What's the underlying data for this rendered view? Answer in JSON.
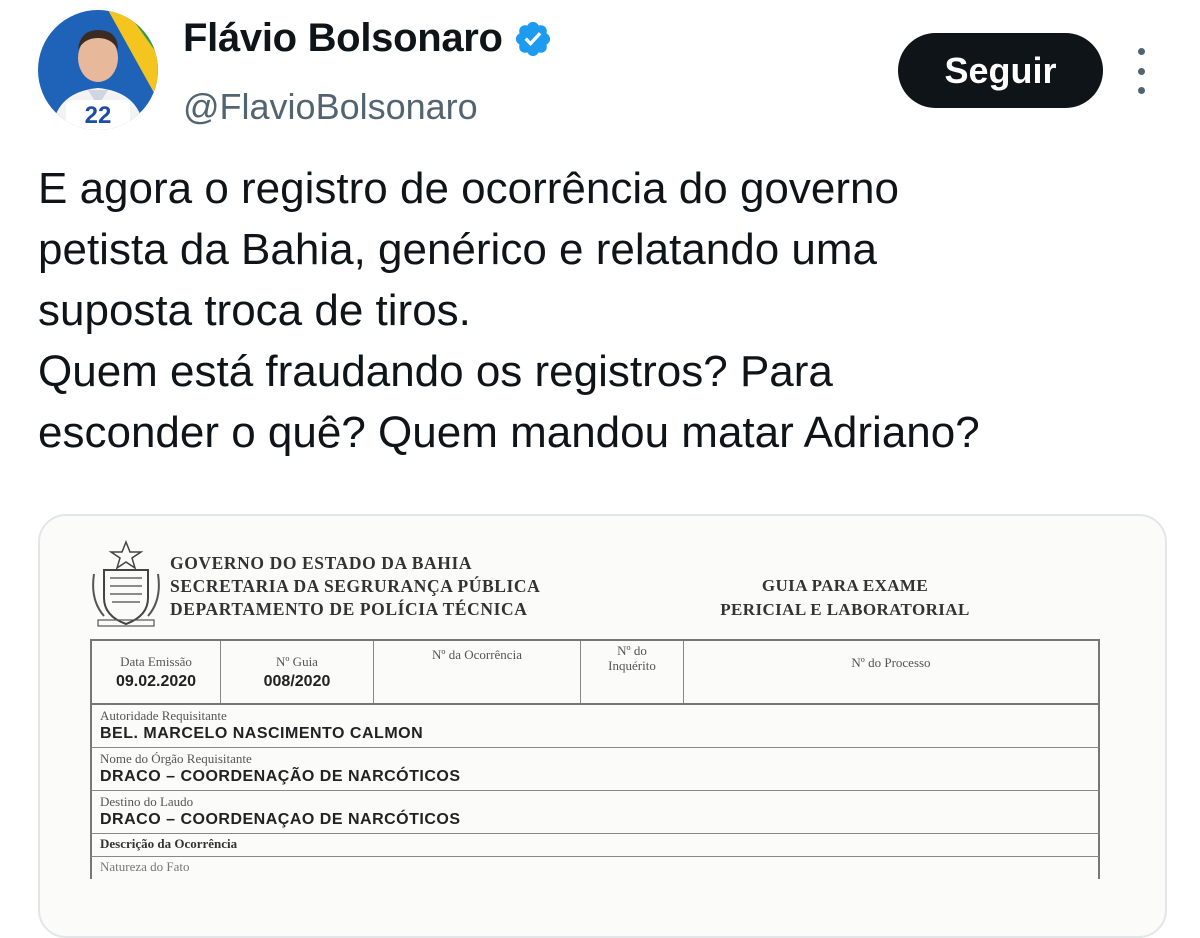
{
  "user": {
    "display_name": "Flávio Bolsonaro",
    "handle": "@FlavioBolsonaro",
    "avatar_badge": "22",
    "verified": true
  },
  "actions": {
    "follow_label": "Seguir",
    "more_icon": "more-vertical-icon"
  },
  "tweet": {
    "lines": [
      "E agora o registro de ocorrência do governo",
      "petista da Bahia, genérico e relatando uma",
      "suposta troca de tiros.",
      "Quem está fraudando os registros? Para",
      "esconder o quê? Quem mandou matar Adriano?"
    ]
  },
  "document": {
    "header": [
      "GOVERNO DO ESTADO DA BAHIA",
      "SECRETARIA DA SEGRURANÇA PÚBLICA",
      "DEPARTAMENTO DE POLÍCIA TÉCNICA"
    ],
    "title": [
      "GUIA PARA EXAME",
      "PERICIAL E LABORATORIAL"
    ],
    "top_fields": {
      "data_emissao": {
        "label": "Data Emissão",
        "value": "09.02.2020"
      },
      "n_guia": {
        "label": "Nº Guia",
        "value": "008/2020"
      },
      "n_ocorrencia": {
        "label": "Nº da Ocorrência",
        "value": ""
      },
      "n_inquerito": {
        "label_1": "Nº do",
        "label_2": "Inquérito",
        "value": ""
      },
      "n_processo": {
        "label": "Nº do Processo",
        "value": ""
      }
    },
    "fields": [
      {
        "label": "Autoridade Requisitante",
        "value": "BEL. MARCELO NASCIMENTO CALMON"
      },
      {
        "label": "Nome do Órgão Requisitante",
        "value": "DRACO – COORDENAÇÃO DE NARCÓTICOS"
      },
      {
        "label": "Destino do Laudo",
        "value": "DRACO – COORDENAÇAO DE NARCÓTICOS"
      }
    ],
    "section_label": "Descrição da Ocorrência",
    "cut_label": "Natureza do Fato"
  },
  "colors": {
    "text_primary": "#0f1419",
    "text_secondary": "#536471",
    "verified_blue": "#1d9bf0",
    "button_bg": "#0f1419"
  }
}
